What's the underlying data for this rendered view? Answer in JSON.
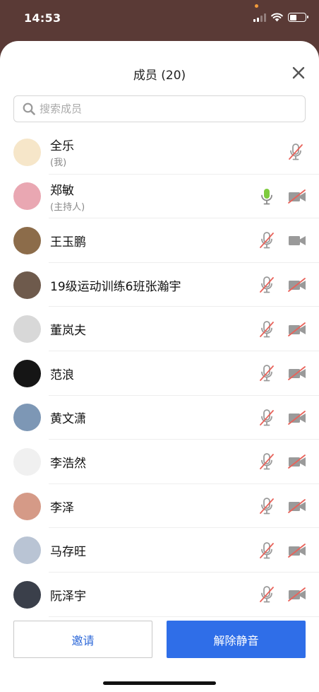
{
  "status_bar": {
    "time": "14:53"
  },
  "sheet": {
    "title": "成员 (20)",
    "search_placeholder": "搜索成员"
  },
  "members": [
    {
      "name": "全乐",
      "role": "(我)",
      "mic": "muted",
      "cam": "none",
      "avatar_color": "#f6e6c9"
    },
    {
      "name": "郑敏",
      "role": "(主持人)",
      "mic": "active",
      "cam": "off",
      "avatar_color": "#e9a7b2"
    },
    {
      "name": "王玉鹏",
      "role": "",
      "mic": "muted",
      "cam": "on",
      "avatar_color": "#8c6c4a"
    },
    {
      "name": "19级运动训练6班张瀚宇",
      "role": "",
      "mic": "muted",
      "cam": "off",
      "avatar_color": "#6e5a4c"
    },
    {
      "name": "董岚夫",
      "role": "",
      "mic": "muted",
      "cam": "off",
      "avatar_color": "#d8d8d8"
    },
    {
      "name": "范浪",
      "role": "",
      "mic": "muted",
      "cam": "off",
      "avatar_color": "#151515"
    },
    {
      "name": "黄文潇",
      "role": "",
      "mic": "muted",
      "cam": "off",
      "avatar_color": "#7d97b5"
    },
    {
      "name": "李浩然",
      "role": "",
      "mic": "muted",
      "cam": "off",
      "avatar_color": "#f0f0f0"
    },
    {
      "name": "李泽",
      "role": "",
      "mic": "muted",
      "cam": "off",
      "avatar_color": "#d59a87"
    },
    {
      "name": "马存旺",
      "role": "",
      "mic": "muted",
      "cam": "off",
      "avatar_color": "#b9c4d4"
    },
    {
      "name": "阮泽宇",
      "role": "",
      "mic": "muted",
      "cam": "off",
      "avatar_color": "#3a3f4a"
    }
  ],
  "footer": {
    "invite_label": "邀请",
    "unmute_all_label": "解除静音"
  },
  "colors": {
    "accent": "#2f6ee8",
    "muted_slash": "#e8625a",
    "icon_gray": "#9a9a9a",
    "mic_active": "#7ecb3f"
  }
}
